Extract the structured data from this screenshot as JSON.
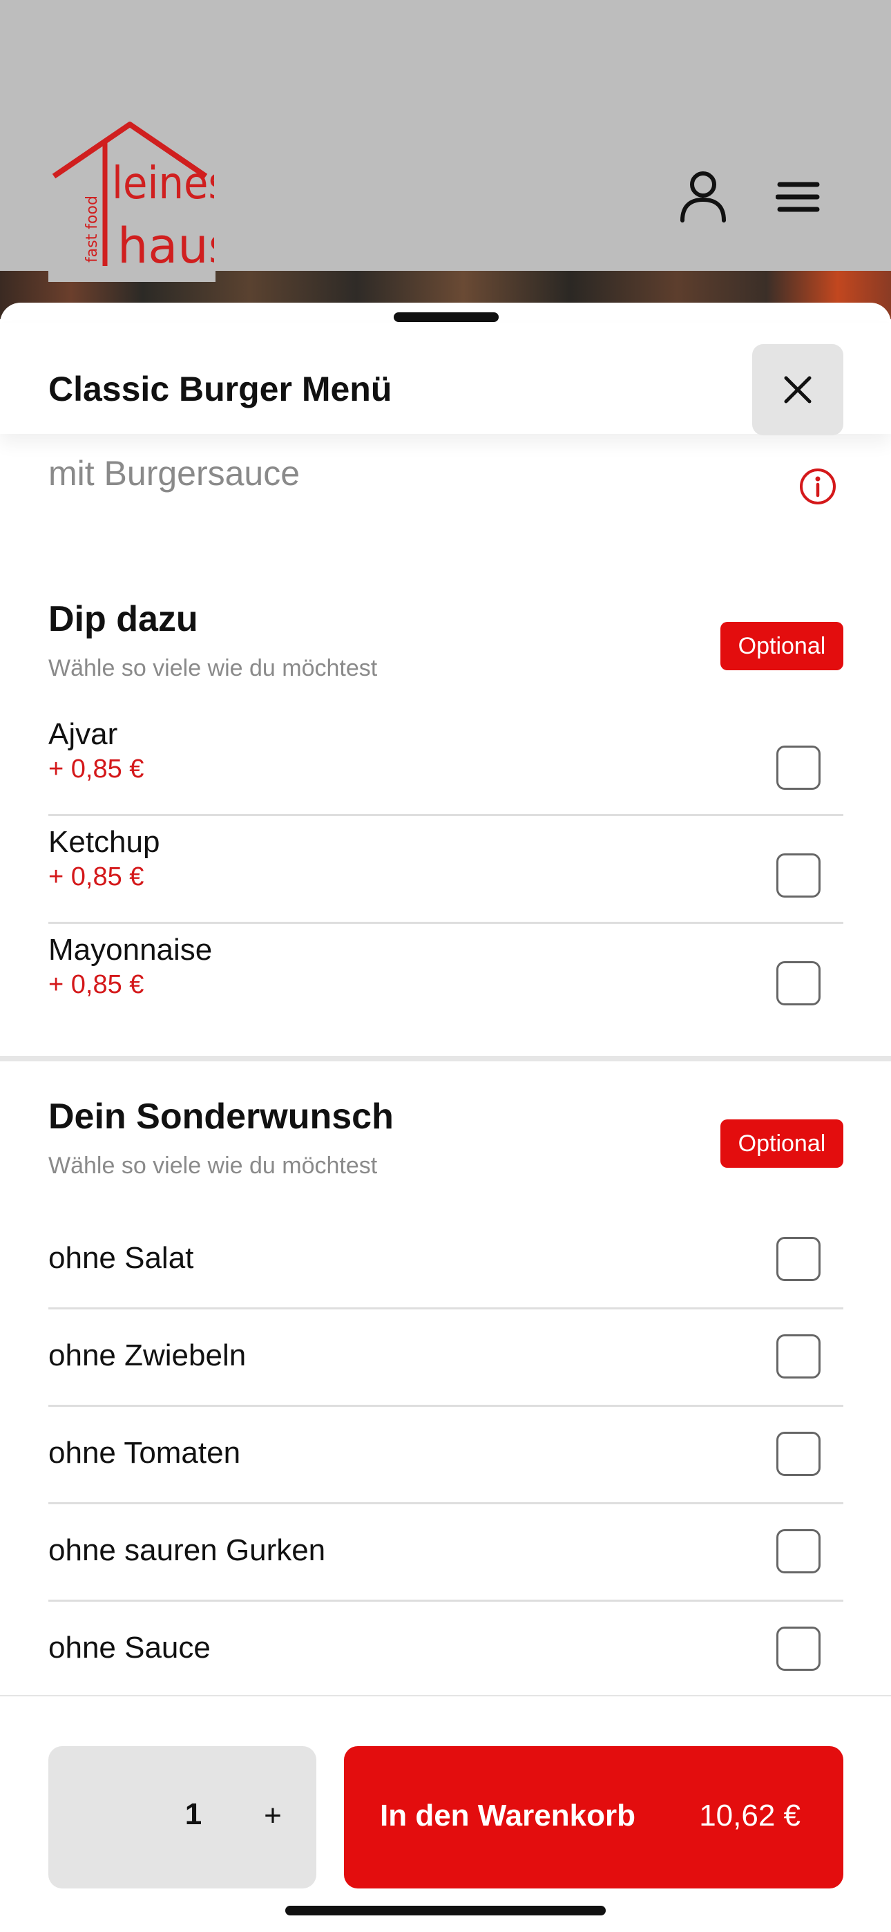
{
  "header": {
    "logo_text": "kleines haus",
    "logo_subtext": "fast food",
    "user_icon": "user-icon",
    "menu_icon": "menu-icon"
  },
  "sheet": {
    "title": "Classic Burger Menü",
    "close_icon": "close-icon",
    "description": "mit Burgersauce",
    "info_icon": "info-icon"
  },
  "groups": [
    {
      "title": "Dip dazu",
      "subtitle": "Wähle so viele wie du möchtest",
      "badge": "Optional",
      "options": [
        {
          "name": "Ajvar",
          "price": "+ 0,85 €",
          "checked": false
        },
        {
          "name": "Ketchup",
          "price": "+ 0,85 €",
          "checked": false
        },
        {
          "name": "Mayonnaise",
          "price": "+ 0,85 €",
          "checked": false
        }
      ]
    },
    {
      "title": "Dein Sonderwunsch",
      "subtitle": "Wähle so viele wie du möchtest",
      "badge": "Optional",
      "options": [
        {
          "name": "ohne Salat",
          "checked": false
        },
        {
          "name": "ohne Zwiebeln",
          "checked": false
        },
        {
          "name": "ohne Tomaten",
          "checked": false
        },
        {
          "name": "ohne sauren Gurken",
          "checked": false
        },
        {
          "name": "ohne Sauce",
          "checked": false
        }
      ]
    }
  ],
  "footer": {
    "quantity": "1",
    "plus_label": "+",
    "cart_label": "In den Warenkorb",
    "cart_price": "10,62 €"
  },
  "colors": {
    "accent": "#e30d0e",
    "price": "#d4181a",
    "header_bg": "#bdbdbd",
    "muted_text": "#8a8a8a"
  }
}
